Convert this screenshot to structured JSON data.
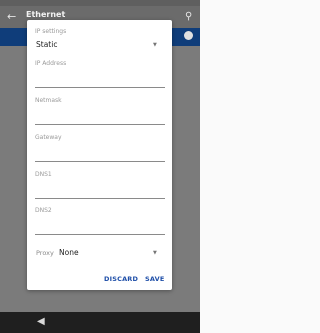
{
  "app_bar": {
    "title": "Ethernet",
    "back_icon": "arrow-back-icon",
    "search_icon": "search-icon"
  },
  "dialog": {
    "ip_settings": {
      "label": "IP settings",
      "value": "Static"
    },
    "fields": [
      {
        "label": "IP Address",
        "value": ""
      },
      {
        "label": "Netmask",
        "value": ""
      },
      {
        "label": "Gateway",
        "value": ""
      },
      {
        "label": "DNS1",
        "value": ""
      },
      {
        "label": "DNS2",
        "value": ""
      }
    ],
    "proxy": {
      "label": "Proxy",
      "value": "None"
    },
    "buttons": {
      "discard": "DISCARD",
      "save": "SAVE"
    }
  },
  "colors": {
    "accent": "#1e4ea8",
    "band": "#0f3d7a"
  }
}
